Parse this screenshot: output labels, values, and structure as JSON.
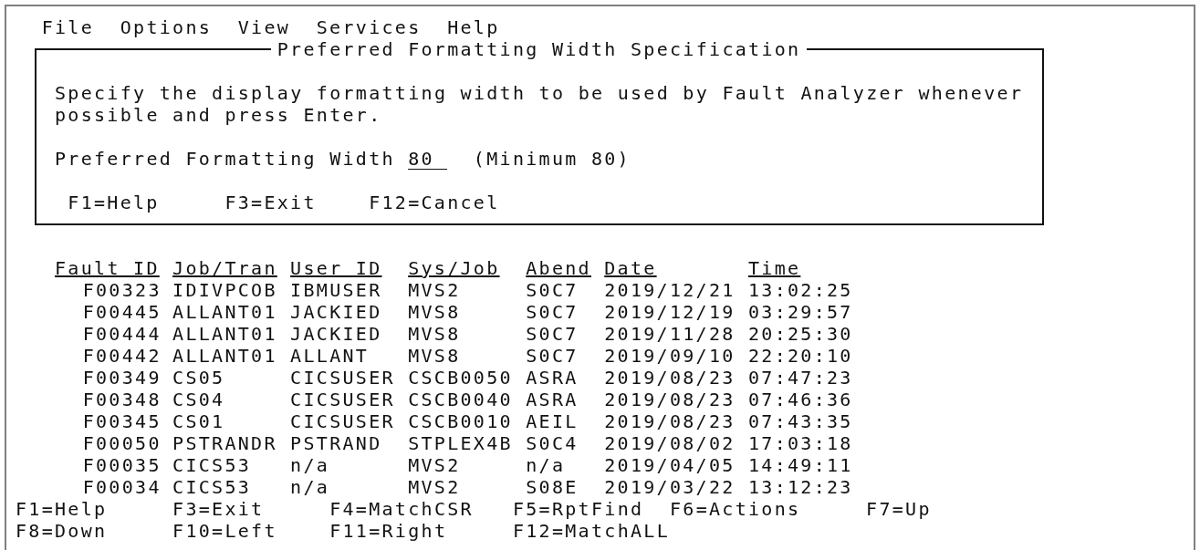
{
  "menu_bar": [
    "File",
    "Options",
    "View",
    "Services",
    "Help"
  ],
  "dialog": {
    "title": "Preferred Formatting Width Specification",
    "message": "Specify the display formatting width to be used by Fault Analyzer whenever possible and press Enter.",
    "field": {
      "label": "Preferred Formatting Width",
      "value": "80",
      "hint": "(Minimum 80)"
    },
    "function_keys": [
      "F1=Help",
      "F3=Exit",
      "F12=Cancel"
    ]
  },
  "table": {
    "columns": [
      "Fault ID",
      "Job/Tran",
      "User ID",
      "Sys/Job",
      "Abend",
      "Date",
      "Time"
    ],
    "rows": [
      [
        "F00323",
        "IDIVPCOB",
        "IBMUSER",
        "MVS2",
        "S0C7",
        "2019/12/21",
        "13:02:25"
      ],
      [
        "F00445",
        "ALLANT01",
        "JACKIED",
        "MVS8",
        "S0C7",
        "2019/12/19",
        "03:29:57"
      ],
      [
        "F00444",
        "ALLANT01",
        "JACKIED",
        "MVS8",
        "S0C7",
        "2019/11/28",
        "20:25:30"
      ],
      [
        "F00442",
        "ALLANT01",
        "ALLANT",
        "MVS8",
        "S0C7",
        "2019/09/10",
        "22:20:10"
      ],
      [
        "F00349",
        "CS05",
        "CICSUSER",
        "CSCB0050",
        "ASRA",
        "2019/08/23",
        "07:47:23"
      ],
      [
        "F00348",
        "CS04",
        "CICSUSER",
        "CSCB0040",
        "ASRA",
        "2019/08/23",
        "07:46:36"
      ],
      [
        "F00345",
        "CS01",
        "CICSUSER",
        "CSCB0010",
        "AEIL",
        "2019/08/23",
        "07:43:35"
      ],
      [
        "F00050",
        "PSTRANDR",
        "PSTRAND",
        "STPLEX4B",
        "S0C4",
        "2019/08/02",
        "17:03:18"
      ],
      [
        "F00035",
        "CICS53",
        "n/a",
        "MVS2",
        "n/a",
        "2019/04/05",
        "14:49:11"
      ],
      [
        "F00034",
        "CICS53",
        "n/a",
        "MVS2",
        "S08E",
        "2019/03/22",
        "13:12:23"
      ]
    ]
  },
  "function_keys": [
    [
      "F1=Help",
      "F3=Exit",
      "F4=MatchCSR",
      "F5=RptFind",
      "F6=Actions",
      "F7=Up"
    ],
    [
      "F8=Down",
      "F10=Left",
      "F11=Right",
      "F12=MatchALL"
    ]
  ]
}
